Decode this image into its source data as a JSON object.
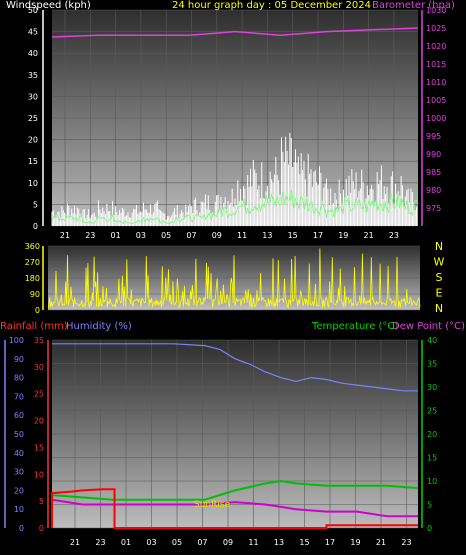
{
  "header": {
    "windspeed_label": "Windspeed (kph)",
    "title": "24 hour graph day : 05 December 2024",
    "barometer_label": "Barometer (hpa)"
  },
  "lower_header": {
    "rainfall_label": "Rainfall (mm)",
    "humidity_label": "Humidity (%)",
    "temperature_label": "Temperature (°C)",
    "dewpoint_label": "Dew Point (°C)"
  },
  "annotation": "SunRise",
  "colors": {
    "windspeed": "#ffffff",
    "windspeed_avg": "#7cfc7c",
    "barometer": "#e040e0",
    "direction": "#ffff00",
    "rainfall": "#ff0000",
    "humidity": "#8080ff",
    "temperature": "#00c000",
    "dewpoint": "#d000d0",
    "title": "#ffff00",
    "axis_left": "#ffffff"
  },
  "chart_data": [
    {
      "type": "line",
      "id": "wind-baro",
      "x_tick_labels": [
        "21",
        "23",
        "01",
        "03",
        "05",
        "07",
        "09",
        "11",
        "13",
        "15",
        "17",
        "19",
        "21",
        "23"
      ],
      "x_range_hours": [
        0,
        24
      ],
      "y_left": {
        "label": "Windspeed (kph)",
        "range": [
          0,
          50
        ],
        "ticks": [
          0,
          5,
          10,
          15,
          20,
          25,
          30,
          35,
          40,
          45,
          50
        ]
      },
      "y_right": {
        "label": "Barometer (hpa)",
        "range": [
          970,
          1030
        ],
        "ticks": [
          975,
          980,
          985,
          990,
          995,
          1000,
          1005,
          1010,
          1015,
          1020,
          1025,
          1030
        ]
      },
      "series": [
        {
          "name": "Windspeed",
          "axis": "left",
          "hourly_peak": [
            5,
            6,
            4,
            6,
            5,
            5,
            6,
            4,
            5,
            7,
            8,
            10,
            14,
            16,
            17,
            22,
            17,
            15,
            11,
            14,
            14,
            15,
            14,
            9
          ]
        },
        {
          "name": "Windspeed average",
          "axis": "left",
          "hourly_peak": [
            2,
            2,
            1,
            2,
            1,
            1,
            2,
            1,
            2,
            2,
            3,
            4,
            5,
            6,
            6,
            7,
            6,
            5,
            4,
            5,
            5,
            6,
            6,
            5
          ]
        },
        {
          "name": "Barometer",
          "axis": "right",
          "x": [
            0,
            3,
            6,
            9,
            12,
            15,
            18,
            21,
            24
          ],
          "values": [
            1022.5,
            1023,
            1023,
            1023,
            1024,
            1023,
            1024,
            1024.5,
            1025
          ]
        }
      ],
      "grid": true
    },
    {
      "type": "scatter",
      "id": "wind-direction",
      "y_ticks": [
        0,
        90,
        180,
        270,
        360
      ],
      "compass_labels": [
        "N",
        "W",
        "S",
        "E",
        "N"
      ],
      "y_range": [
        0,
        360
      ],
      "series": [
        {
          "name": "Wind direction",
          "dominant_band": [
            0,
            90
          ]
        }
      ]
    },
    {
      "type": "line",
      "id": "temp-hum-rain",
      "x_tick_labels": [
        "21",
        "23",
        "01",
        "03",
        "05",
        "07",
        "09",
        "11",
        "13",
        "15",
        "17",
        "19",
        "21",
        "23"
      ],
      "y_left_outer": {
        "label": "Rainfall (mm)",
        "range": [
          0,
          35
        ],
        "ticks": [
          0,
          5,
          10,
          15,
          20,
          25,
          30,
          35
        ]
      },
      "y_left_inner": {
        "label": "Humidity (%)",
        "range": [
          0,
          100
        ],
        "ticks": [
          0,
          10,
          20,
          30,
          40,
          50,
          60,
          70,
          80,
          90,
          100
        ]
      },
      "y_right": {
        "label": "Temperature (°C)",
        "range": [
          0,
          40
        ],
        "ticks": [
          0,
          5,
          10,
          15,
          20,
          25,
          30,
          35,
          40
        ]
      },
      "series": [
        {
          "name": "Rainfall",
          "axis": "left_outer",
          "x": [
            0,
            0,
            1,
            2,
            3.3,
            3.3,
            4.1,
            4.1,
            18,
            18,
            24
          ],
          "values": [
            0,
            6.5,
            6.7,
            7,
            7.2,
            7.2,
            7.2,
            0,
            0,
            0.5,
            0.5
          ]
        },
        {
          "name": "Humidity",
          "axis": "left_inner",
          "x": [
            0,
            2,
            4,
            6,
            8,
            10,
            11,
            12,
            13,
            14,
            15,
            16,
            17,
            18,
            19,
            20,
            21,
            22,
            23,
            24
          ],
          "values": [
            98,
            98,
            98,
            98,
            98,
            97,
            95,
            90,
            87,
            83,
            80,
            78,
            80,
            79,
            77,
            76,
            75,
            74,
            73,
            73
          ]
        },
        {
          "name": "Temperature",
          "axis": "right",
          "x": [
            0,
            2,
            4,
            6,
            8,
            10,
            12,
            14,
            15,
            16,
            18,
            20,
            22,
            24
          ],
          "values": [
            7,
            6.5,
            6,
            6,
            6,
            6,
            8,
            9.5,
            10,
            9.5,
            9,
            9,
            9,
            8.5
          ]
        },
        {
          "name": "Dew Point",
          "axis": "right",
          "x": [
            0,
            2,
            4,
            6,
            8,
            10,
            12,
            14,
            16,
            18,
            20,
            22,
            24
          ],
          "values": [
            6,
            5,
            5,
            5,
            5,
            5,
            5.5,
            5,
            4,
            3.5,
            3.5,
            2.5,
            2.5
          ]
        }
      ],
      "annotations": [
        {
          "text": "SunRise",
          "x": 8.5
        }
      ],
      "grid": true
    }
  ]
}
